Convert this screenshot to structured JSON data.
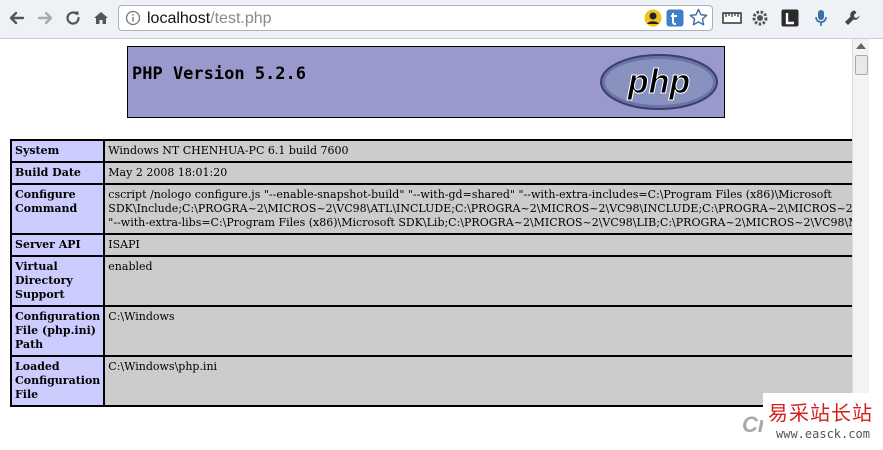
{
  "browser": {
    "url_host": "localhost",
    "url_path": "/test.php"
  },
  "header": {
    "title": "PHP Version 5.2.6",
    "logo_text": "php"
  },
  "rows": [
    {
      "key": "System",
      "value": "Windows NT CHENHUA-PC 6.1 build 7600"
    },
    {
      "key": "Build Date",
      "value": "May 2 2008 18:01:20"
    },
    {
      "key": "Configure Command",
      "value": "cscript /nologo configure.js \"--enable-snapshot-build\" \"--with-gd=shared\" \"--with-extra-includes=C:\\Program Files (x86)\\Microsoft SDK\\Include;C:\\PROGRA~2\\MICROS~2\\VC98\\ATL\\INCLUDE;C:\\PROGRA~2\\MICROS~2\\VC98\\INCLUDE;C:\\PROGRA~2\\MICROS~2\\VC98\\MFC\\INCLUDE\" \"--with-extra-libs=C:\\Program Files (x86)\\Microsoft SDK\\Lib;C:\\PROGRA~2\\MICROS~2\\VC98\\LIB;C:\\PROGRA~2\\MICROS~2\\VC98\\MFC\\LIB\""
    },
    {
      "key": "Server API",
      "value": "ISAPI"
    },
    {
      "key": "Virtual Directory Support",
      "value": "enabled"
    },
    {
      "key": "Configuration File (php.ini) Path",
      "value": "C:\\Windows"
    },
    {
      "key": "Loaded Configuration File",
      "value": "C:\\Windows\\php.ini"
    }
  ],
  "watermark": {
    "chinese": "易采站长站",
    "url": "www.easck.com",
    "cr_text": "Cr"
  },
  "colors": {
    "header_bg": "#9999cc",
    "key_bg": "#ccccff",
    "value_bg": "#cccccc"
  }
}
